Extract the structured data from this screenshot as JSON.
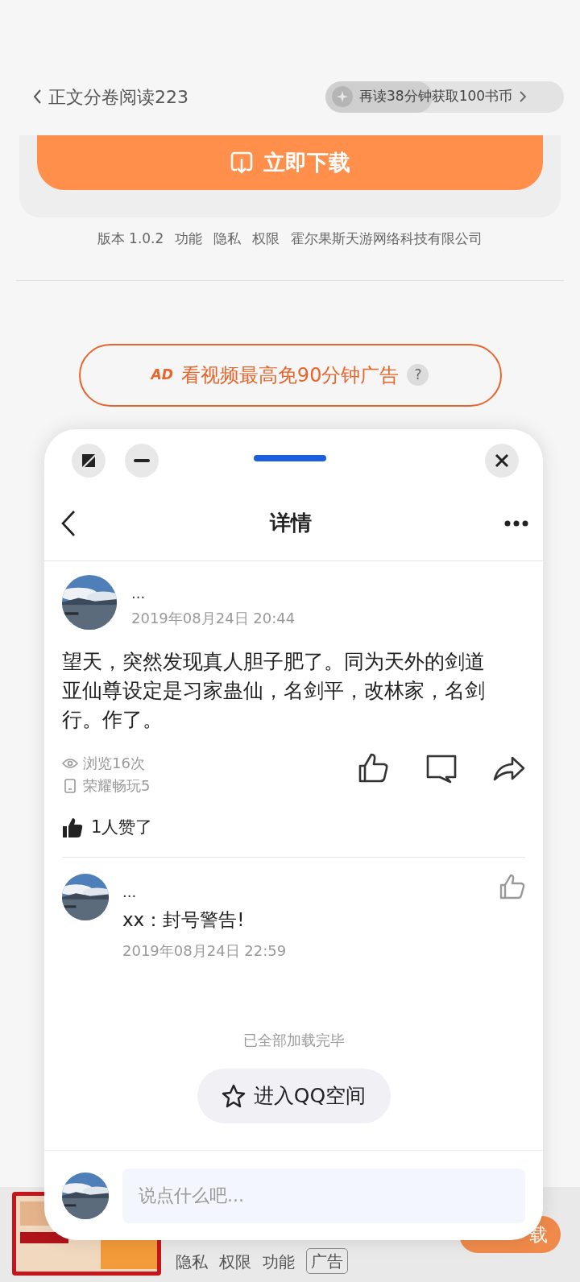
{
  "header": {
    "title": "正文分卷阅读223",
    "reward": {
      "text": "再读38分钟获取100书币",
      "level": 0.45
    }
  },
  "download_card": {
    "button": "立即下载"
  },
  "app_info": [
    "版本 1.0.2",
    "功能",
    "隐私",
    "权限",
    "霍尔果斯天游网络科技有限公司"
  ],
  "ad_free_button": {
    "badge": "AD",
    "label": "看视频最高免90分钟广告",
    "help": "?"
  },
  "bottom_ad": {
    "button": "载",
    "links": [
      {
        "label": "隐私",
        "kind": "link"
      },
      {
        "label": "权限",
        "kind": "link"
      },
      {
        "label": "功能",
        "kind": "link"
      },
      {
        "label": "广告",
        "kind": "tag"
      }
    ]
  },
  "overlay": {
    "title": "详情",
    "post": {
      "author": "...",
      "time": "2019年08月24日 20:44",
      "text": "望天，突然发现真人胆子肥了。同为天外的剑道亚仙尊设定是习家蛊仙，名剑平，改林家，名剑行。作了。",
      "views": "浏览16次",
      "device": "荣耀畅玩5",
      "likes": "1人赞了"
    },
    "comments": [
      {
        "author": "...",
        "text": "xx：封号警告!",
        "time": "2019年08月24日 22:59"
      }
    ],
    "end_note": "已全部加载完毕",
    "qzone_button": "进入QQ空间",
    "comment_input": {
      "placeholder": "说点什么吧..."
    }
  }
}
